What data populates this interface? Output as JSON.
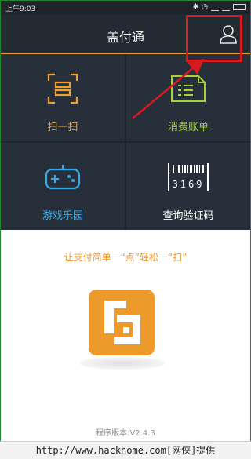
{
  "status_bar": {
    "time": "上午9:03"
  },
  "header": {
    "title": "盖付通"
  },
  "menu": {
    "items": [
      {
        "label": "扫一扫",
        "color": "#f0a12a",
        "icon": "scan-icon"
      },
      {
        "label": "消费账单",
        "color": "#a4d239",
        "icon": "bill-icon"
      },
      {
        "label": "游戏乐园",
        "color": "#37a9e8",
        "icon": "gamepad-icon"
      },
      {
        "label": "查询验证码",
        "color": "#ffffff",
        "icon": "barcode-icon",
        "code": "3169"
      }
    ]
  },
  "main": {
    "slogan": "让支付简单一“点”轻松一“扫”",
    "version": "程序版本:V2.4.3"
  },
  "watermark": {
    "text": "http://www.hackhome.com[网侠]提供"
  },
  "colors": {
    "accent": "#e59c2b",
    "highlight": "#d9191f"
  }
}
